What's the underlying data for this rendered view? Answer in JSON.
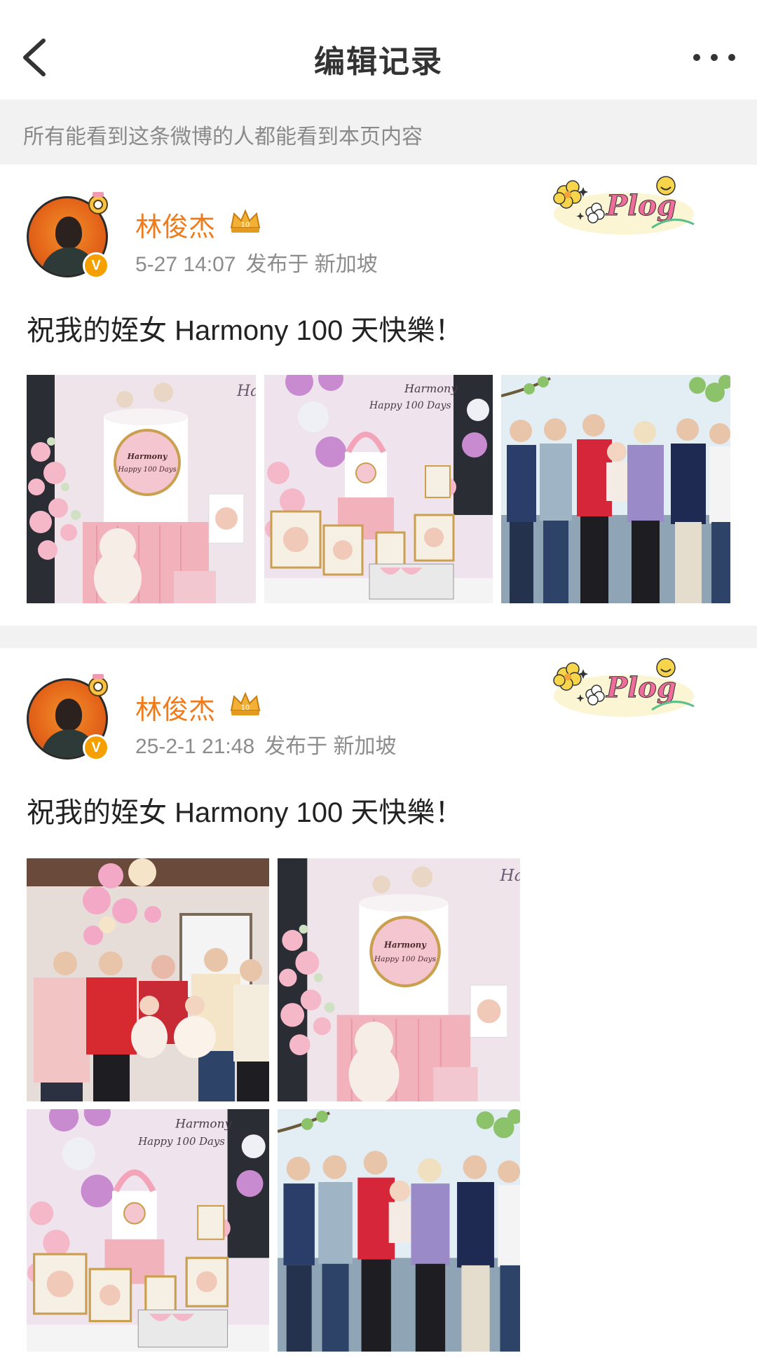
{
  "nav": {
    "title": "编辑记录",
    "back_icon": "chevron-left-icon",
    "more_icon": "more-dots-icon"
  },
  "notice": {
    "text": "所有能看到这条微博的人都能看到本页内容"
  },
  "posts": [
    {
      "username": "林俊杰",
      "time": "5-27 14:07",
      "published_at": "发布于 新加坡",
      "text": "祝我的姪女 Harmony 100 天快樂！",
      "sticker": "Plog",
      "images": [
        "cake-closeup",
        "cake-table",
        "group-photo-outdoor"
      ]
    },
    {
      "username": "林俊杰",
      "time": "25-2-1 21:48",
      "published_at": "发布于 新加坡",
      "text": "祝我的姪女 Harmony 100 天快樂！",
      "sticker": "Plog",
      "images": [
        "family-photo",
        "cake-closeup",
        "cake-table",
        "group-photo-outdoor"
      ]
    }
  ],
  "cake_label": {
    "line1": "Harmony",
    "line2": "Happy 100 Days"
  },
  "colors": {
    "username": "#ef7b1c",
    "meta": "#8c8c8c",
    "notice_bg": "#f2f2f2",
    "verified": "#f5a000"
  }
}
